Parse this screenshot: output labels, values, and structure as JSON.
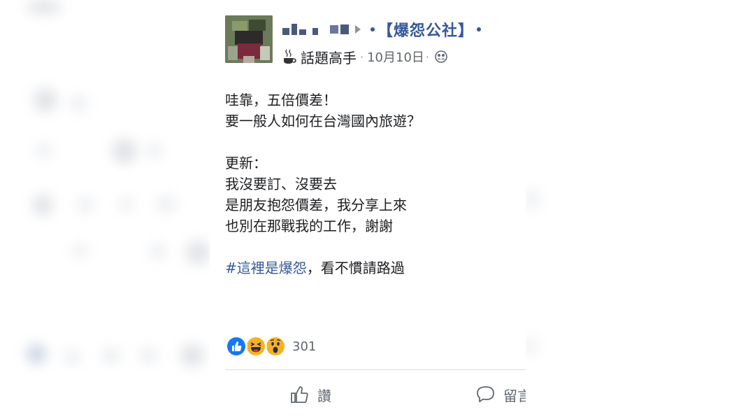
{
  "post": {
    "group_name": "【爆怨公社】",
    "badge": "話題高手",
    "date": "10月10日",
    "lines_1": [
      "哇靠，五倍價差！",
      "要一般人如何在台灣國內旅遊？"
    ],
    "lines_2": [
      "更新：",
      "我沒要訂、沒要去",
      "是朋友抱怨價差，我分享上來",
      "也別在那戰我的工作，謝謝"
    ],
    "hashtag": "#這裡是爆怨",
    "hashtag_tail": "，看不慣請路過"
  },
  "reactions": {
    "icons": [
      "like-icon",
      "haha-icon",
      "wow-icon"
    ],
    "count": "301"
  },
  "actions": {
    "like_label": "讚",
    "comment_label": "留言"
  },
  "colors": {
    "link": "#365899",
    "text": "#1c1e21",
    "muted": "#606770",
    "like_blue": "#1877f2",
    "emoji_yellow": "#f7b125"
  }
}
